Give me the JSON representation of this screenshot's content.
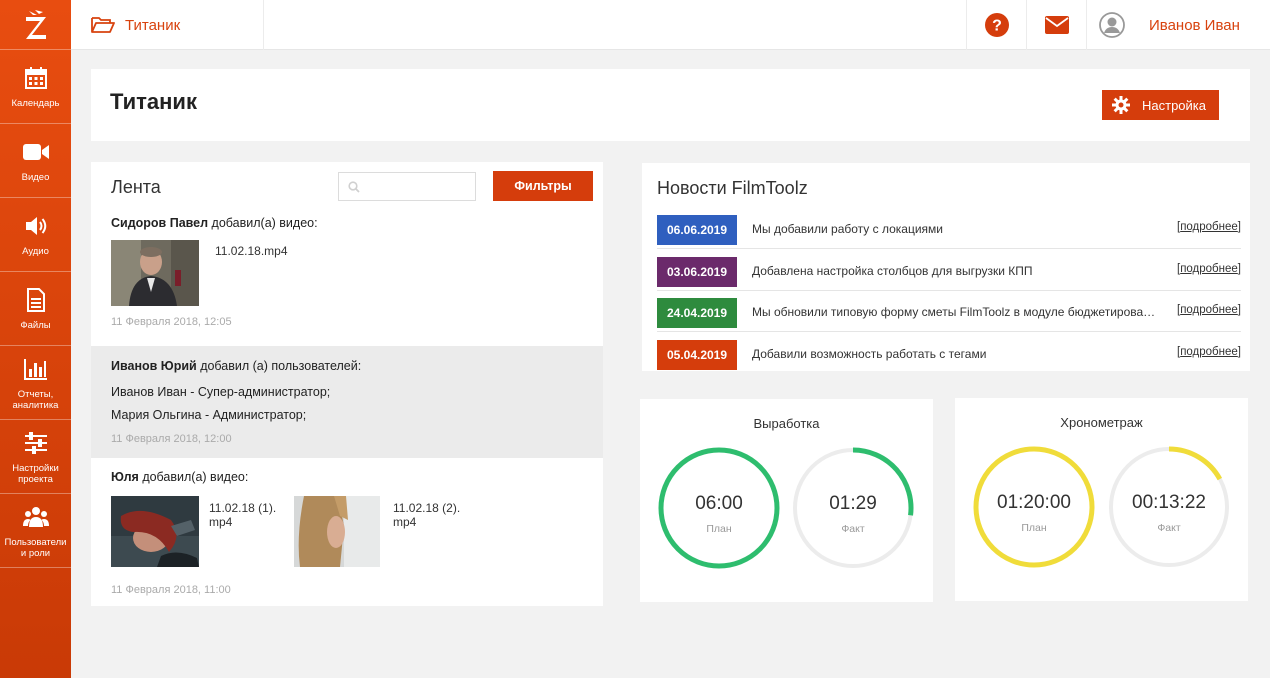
{
  "sidebar": {
    "logo_icon": "z-logo-icon",
    "items": [
      {
        "label": "Календарь",
        "icon": "calendar-icon"
      },
      {
        "label": "Видео",
        "icon": "video-camera-icon"
      },
      {
        "label": "Аудио",
        "icon": "speaker-icon"
      },
      {
        "label": "Файлы",
        "icon": "file-icon"
      },
      {
        "label": "Отчеты,\nаналитика",
        "icon": "bar-chart-icon"
      },
      {
        "label": "Настройки\nпроекта",
        "icon": "sliders-icon"
      },
      {
        "label": "Пользователи\nи роли",
        "icon": "users-icon"
      }
    ]
  },
  "topbar": {
    "breadcrumb": "Титаник",
    "help_icon": "help-icon",
    "mail_icon": "envelope-icon",
    "user_name": "Иванов Иван"
  },
  "header": {
    "title": "Титаник",
    "settings_label": "Настройка"
  },
  "feed": {
    "title": "Лента",
    "search_placeholder": "",
    "filters_label": "Фильтры",
    "entries": [
      {
        "author": "Сидоров Павел",
        "action": "добавил(а) видео:",
        "files": [
          "11.02.18.mp4"
        ],
        "date": "11 Февраля 2018, 12:05"
      },
      {
        "author": "Иванов Юрий",
        "action": "добавил (а) пользователей:",
        "lines": [
          "Иванов Иван - Супер-администратор;",
          "Мария Ольгина - Администратор;"
        ],
        "date": "11 Февраля 2018, 12:00"
      },
      {
        "author": "Юля",
        "action": "добавил(а) видео:",
        "files": [
          "11.02.18 (1).\nmp4",
          "11.02.18 (2).\nmp4"
        ],
        "date": "11 Февраля 2018, 11:00"
      }
    ]
  },
  "news": {
    "title": "Новости FilmToolz",
    "more_label": "подробнее",
    "items": [
      {
        "date": "06.06.2019",
        "color": "#2f5fbf",
        "text": "Мы добавили работу с локациями"
      },
      {
        "date": "03.06.2019",
        "color": "#6b2a6b",
        "text": "Добавлена настройка столбцов для выгрузки КПП"
      },
      {
        "date": "24.04.2019",
        "color": "#2e8b3e",
        "text": "Мы обновили типовую форму сметы FilmToolz в модуле бюджетирова…"
      },
      {
        "date": "05.04.2019",
        "color": "#d53d0c",
        "text": "Добавили возможность работать с тегами"
      }
    ]
  },
  "timers": [
    {
      "title": "Выработка",
      "color": "#2ebd6e",
      "plan": {
        "value": "06:00",
        "label": "План",
        "fraction": 1.0
      },
      "fact": {
        "value": "01:29",
        "label": "Факт",
        "fraction": 0.27
      }
    },
    {
      "title": "Хронометраж",
      "color": "#f0dc3a",
      "plan": {
        "value": "01:20:00",
        "label": "План",
        "fraction": 1.0
      },
      "fact": {
        "value": "00:13:22",
        "label": "Факт",
        "fraction": 0.17
      }
    }
  ],
  "colors": {
    "accent": "#d53d0c",
    "sidebar_top": "#e84d10"
  }
}
